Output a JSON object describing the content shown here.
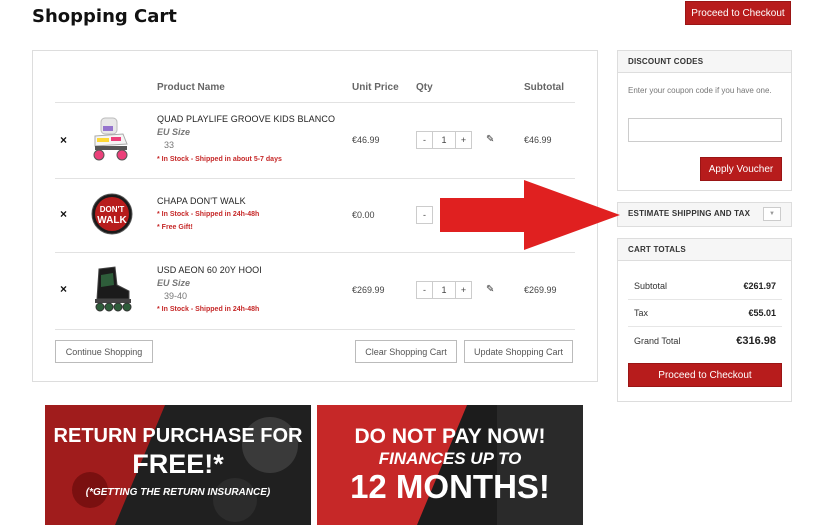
{
  "page": {
    "title": "Shopping Cart"
  },
  "header": {
    "checkout_label": "Proceed to Checkout"
  },
  "cart": {
    "columns": {
      "product": "Product Name",
      "unit_price": "Unit Price",
      "qty": "Qty",
      "subtotal": "Subtotal"
    },
    "remove_icon": "×",
    "edit_icon": "✎",
    "minus": "-",
    "plus": "+",
    "items": [
      {
        "name": "QUAD PLAYLIFE GROOVE KIDS BLANCO",
        "option_label": "EU Size",
        "option_value": "33",
        "stock": "* In Stock - Shipped in about 5-7 days",
        "gift": "",
        "unit_price": "€46.99",
        "qty": "1",
        "subtotal": "€46.99"
      },
      {
        "name": "CHAPA DON'T WALK",
        "option_label": "",
        "option_value": "",
        "stock": "* In Stock - Shipped in 24h-48h",
        "gift": "* Free Gift!",
        "unit_price": "€0.00",
        "qty": "",
        "subtotal": ""
      },
      {
        "name": "USD AEON 60 20Y HOOI",
        "option_label": "EU Size",
        "option_value": "39-40",
        "stock": "* In Stock - Shipped in 24h-48h",
        "gift": "",
        "unit_price": "€269.99",
        "qty": "1",
        "subtotal": "€269.99"
      }
    ],
    "badge_text": {
      "top": "DON'T",
      "bottom": "WALK"
    },
    "continue_label": "Continue Shopping",
    "clear_label": "Clear Shopping Cart",
    "update_label": "Update Shopping Cart"
  },
  "discount": {
    "heading": "DISCOUNT CODES",
    "hint": "Enter your coupon code if you have one.",
    "input_value": "",
    "apply_label": "Apply Voucher"
  },
  "shipping": {
    "heading": "ESTIMATE SHIPPING AND TAX",
    "toggle_icon": "▼"
  },
  "totals": {
    "heading": "CART TOTALS",
    "subtotal_label": "Subtotal",
    "subtotal_value": "€261.97",
    "tax_label": "Tax",
    "tax_value": "€55.01",
    "grand_label": "Grand Total",
    "grand_value": "€316.98",
    "checkout_label": "Proceed to Checkout"
  },
  "banners": {
    "return": {
      "line1": "RETURN PURCHASE FOR",
      "line2": "FREE!*",
      "line3": "(*GETTING THE RETURN INSURANCE)"
    },
    "finance": {
      "line1": "DO NOT PAY NOW!",
      "line2": "FINANCES UP TO",
      "line3": "12 MONTHS!"
    }
  },
  "colors": {
    "accent": "#b71c1c",
    "arrow": "#e02020",
    "stock": "#c62828"
  }
}
